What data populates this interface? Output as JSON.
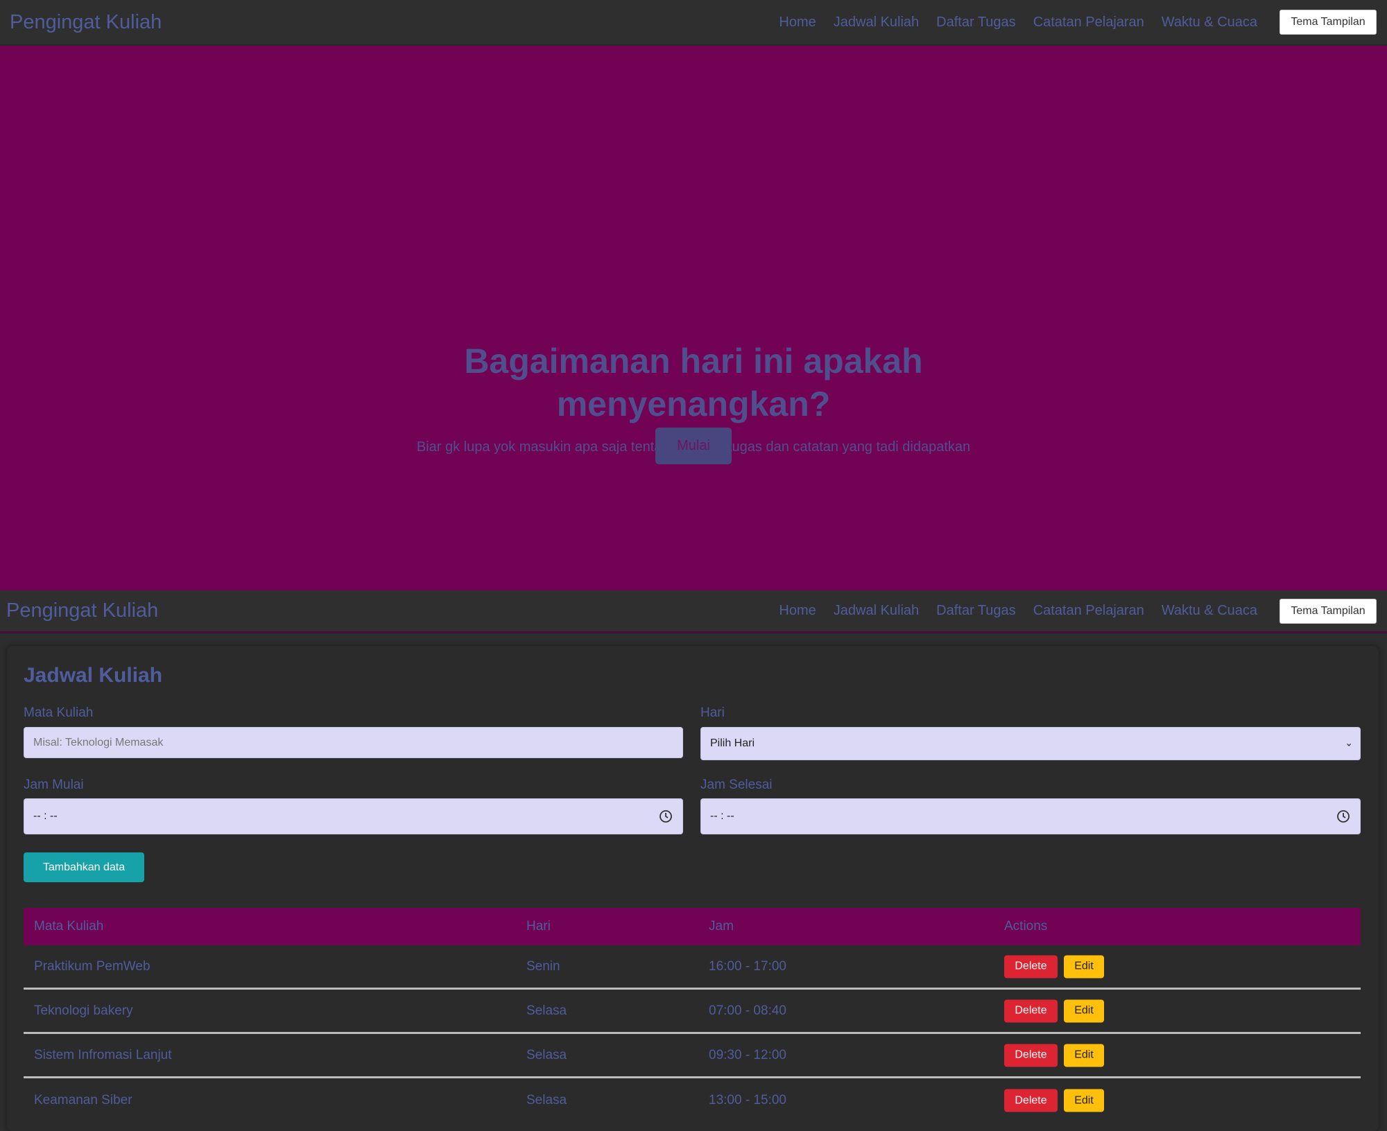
{
  "app": {
    "brand": "Pengingat Kuliah"
  },
  "nav": {
    "items": [
      {
        "label": "Home"
      },
      {
        "label": "Jadwal Kuliah"
      },
      {
        "label": "Daftar Tugas"
      },
      {
        "label": "Catatan Pelajaran"
      },
      {
        "label": "Waktu & Cuaca"
      }
    ],
    "theme_button": "Tema Tampilan"
  },
  "hero": {
    "title_line1": "Bagaimanan hari ini apakah",
    "title_line2": "menyenangkan?",
    "subtitle": "Biar gk lupa yok masukin apa saja tentang jadwal, tugas dan catatan yang tadi didapatkan",
    "start_button": "Mulai"
  },
  "schedule": {
    "title": "Jadwal Kuliah",
    "form": {
      "course_label": "Mata Kuliah",
      "course_placeholder": "Misal: Teknologi Memasak",
      "day_label": "Hari",
      "day_selected": "Pilih Hari",
      "start_label": "Jam Mulai",
      "start_value": "-- : --",
      "end_label": "Jam Selesai",
      "end_value": "-- : --",
      "add_button": "Tambahkan data"
    },
    "table": {
      "headers": [
        "Mata Kuliah",
        "Hari",
        "Jam",
        "Actions"
      ],
      "rows": [
        {
          "course": "Praktikum PemWeb",
          "day": "Senin",
          "time": "16:00 - 17:00"
        },
        {
          "course": "Teknologi bakery",
          "day": "Selasa",
          "time": "07:00 - 08:40"
        },
        {
          "course": "Sistem Infromasi Lanjut",
          "day": "Selasa",
          "time": "09:30 - 12:00"
        },
        {
          "course": "Keamanan Siber",
          "day": "Selasa",
          "time": "13:00 - 15:00"
        }
      ],
      "delete_label": "Delete",
      "edit_label": "Edit"
    }
  },
  "colors": {
    "hero_bg": "#720354",
    "accent_text": "#4f5d9c",
    "add_button": "#16a2a8",
    "delete_button": "#dc2433",
    "edit_button": "#ffc00b"
  }
}
